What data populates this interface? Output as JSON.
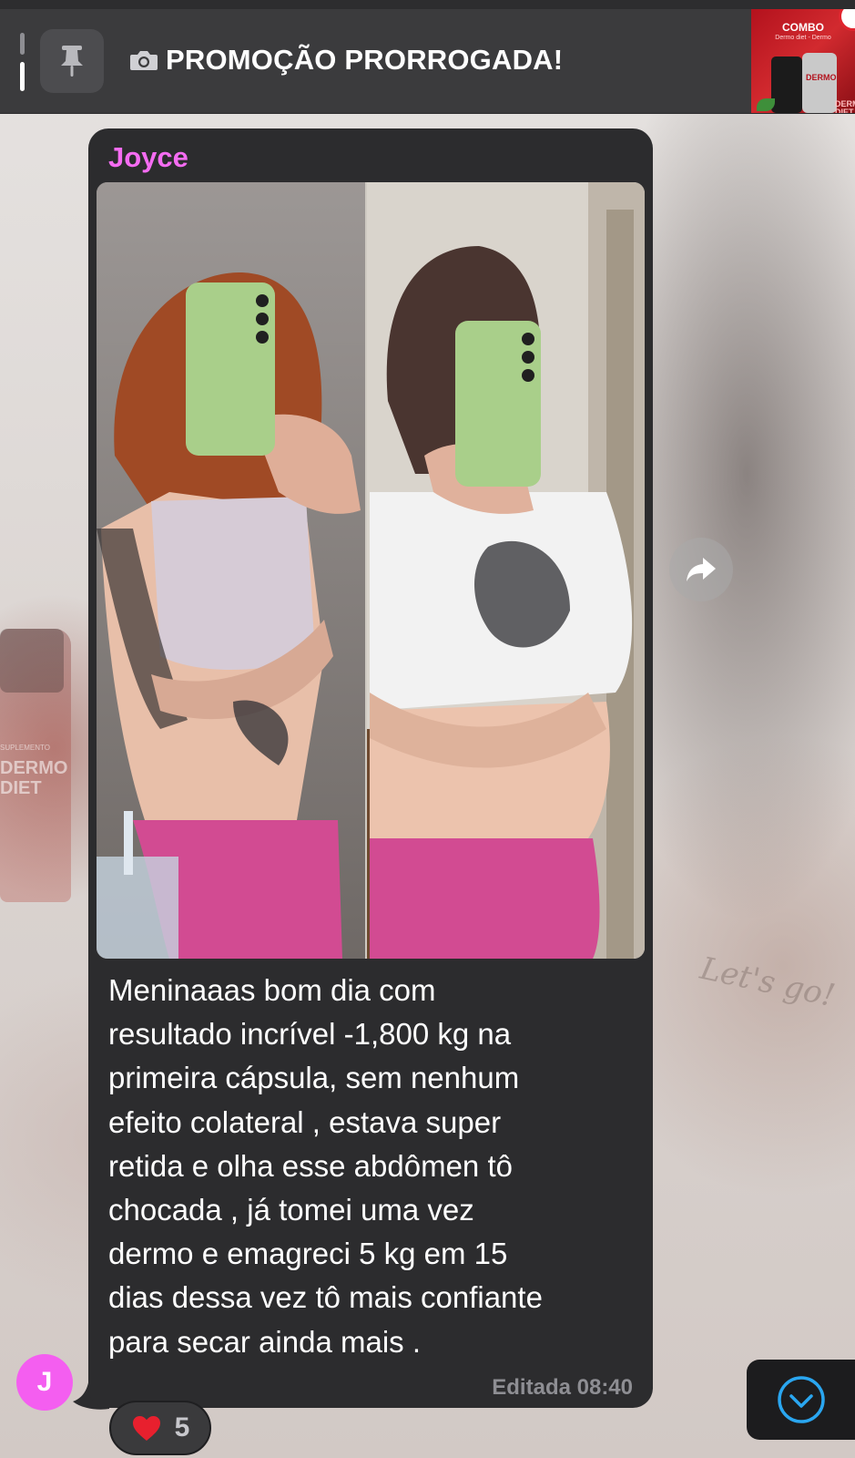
{
  "pinned": {
    "title": "PROMOÇÃO PRORROGADA!",
    "pin_icon": "pin-icon",
    "camera_icon": "camera-icon",
    "thumbnail": {
      "heading": "COMBO",
      "subheading": "Dermo diet - Dermo",
      "jar_label": "DERMO",
      "corner_text": "DERMO DIET"
    }
  },
  "message": {
    "sender": "Joyce",
    "text": "Meninaaas bom dia com\nresultado incrível -1,800 kg na\nprimeira cápsula,  sem nenhum\nefeito colateral , estava super\nretida e olha esse abdômen  tô\nchocada , já tomei uma vez\ndermo e emagreci 5 kg em 15\ndias dessa vez tô mais confiante\npara secar ainda mais .",
    "meta": "Editada 08:40",
    "reaction": {
      "emoji": "❤️",
      "count": "5"
    },
    "avatar_letter": "J"
  },
  "background": {
    "bottle_label_small": "SUPLEMENTO",
    "bottle_label": "DERMO DIET",
    "script_text": "Let's go!"
  },
  "colors": {
    "header_bg": "#3b3b3d",
    "bubble_bg": "#2c2c2e",
    "sender_color": "#f56cf2",
    "avatar_bg": "#f45ef0",
    "scroll_icon": "#2aa6f0"
  },
  "icons": {
    "forward": "forward-arrow-icon",
    "scroll_down": "chevron-down-circle-icon"
  }
}
